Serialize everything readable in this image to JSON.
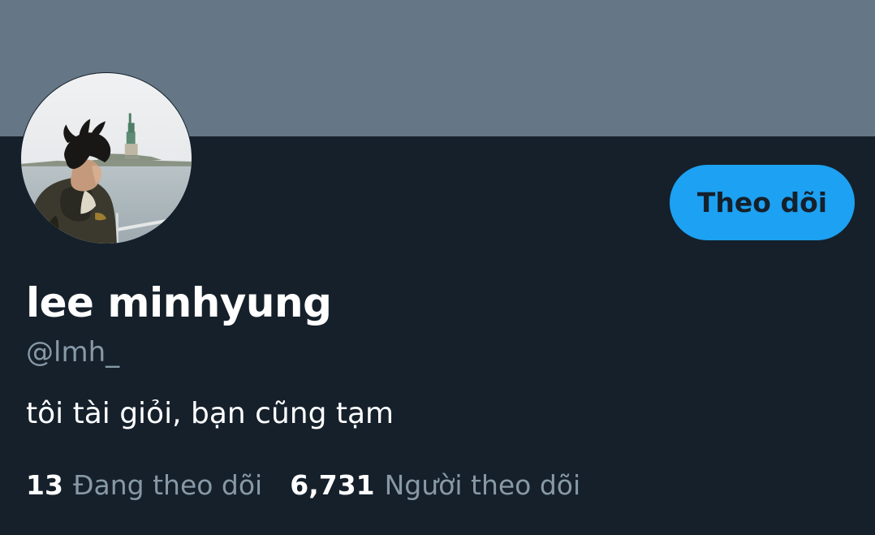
{
  "colors": {
    "banner": "#657786",
    "background": "#15202b",
    "accent": "#1da1f2",
    "primary_text": "#ffffff",
    "secondary_text": "#8899a6"
  },
  "profile": {
    "avatar_icon": "profile-photo",
    "display_name": "lee minhyung",
    "handle": "@lmh_",
    "bio": "tôi tài giỏi, bạn cũng tạm",
    "follow_button_label": "Theo dõi"
  },
  "stats": {
    "following_count": "13",
    "following_label": "Đang theo dõi",
    "followers_count": "6,731",
    "followers_label": "Người theo dõi"
  }
}
